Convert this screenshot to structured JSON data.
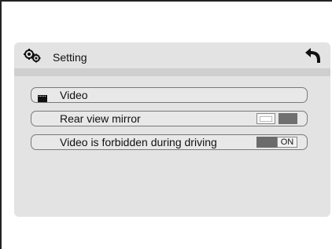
{
  "header": {
    "title": "Setting",
    "icons": {
      "settings": "gear-icon",
      "back": "back-arrow-icon"
    }
  },
  "menu": {
    "items": [
      {
        "label": "Video",
        "icon": "video-icon",
        "selected": true
      },
      {
        "label": "Rear view mirror",
        "toggle": {
          "state": "off"
        }
      },
      {
        "label": "Video is forbidden during driving",
        "toggle": {
          "state": "on",
          "label": "ON"
        }
      }
    ]
  },
  "colors": {
    "panel_bg": "#e3e3e3",
    "header_bar": "#cfcfcf",
    "row_border": "#7a7a7a",
    "toggle_dark": "#6b6b6b"
  }
}
